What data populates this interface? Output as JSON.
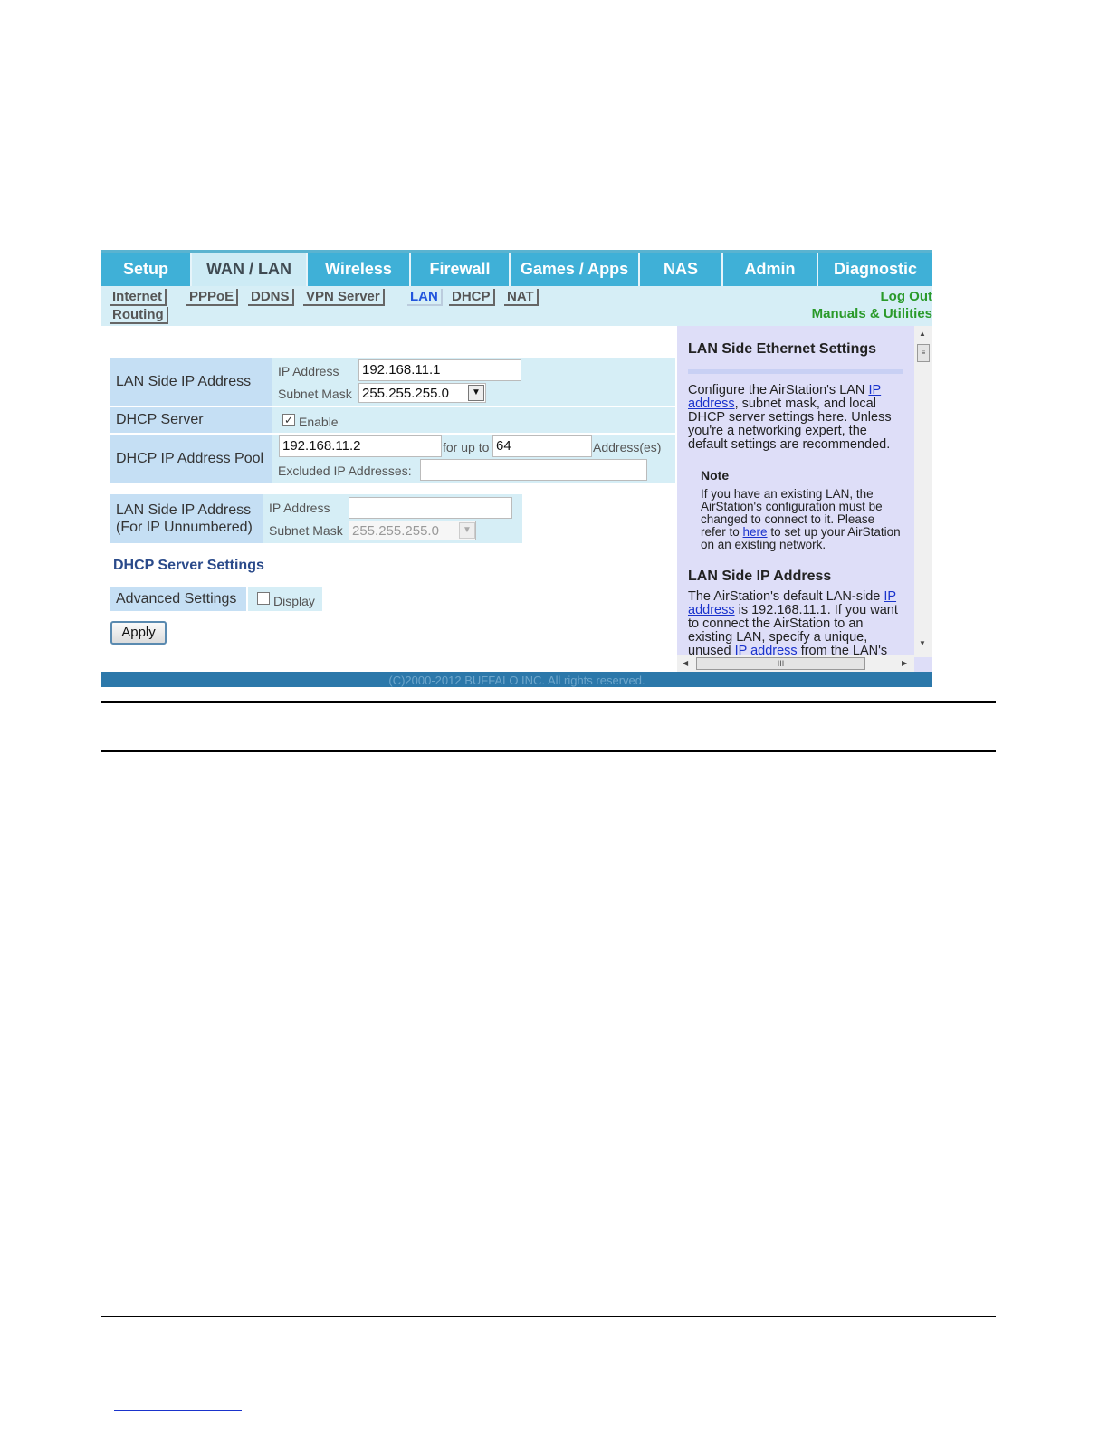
{
  "nav": {
    "tabs": [
      "Setup",
      "WAN / LAN",
      "Wireless",
      "Firewall",
      "Games / Apps",
      "NAS",
      "Admin",
      "Diagnostic"
    ],
    "active_tab": "WAN / LAN",
    "subtabs": [
      "Internet",
      "PPPoE",
      "DDNS",
      "VPN Server",
      "LAN",
      "DHCP",
      "NAT",
      "Routing"
    ],
    "active_subtab": "LAN",
    "logout": "Log Out",
    "manuals": "Manuals & Utilities"
  },
  "form": {
    "lan_ip_label": "LAN Side IP Address",
    "ip_address_label": "IP Address",
    "ip_address_value": "192.168.11.1",
    "subnet_mask_label": "Subnet Mask",
    "subnet_mask_value": "255.255.255.0",
    "dhcp_server_label": "DHCP Server",
    "dhcp_enable_label": "Enable",
    "pool_label": "DHCP IP Address Pool",
    "pool_start": "192.168.11.2",
    "for_up_to": "for up to",
    "pool_count": "64",
    "addresses_label": "Address(es)",
    "excluded_label": "Excluded IP Addresses:",
    "excluded_value": "",
    "unnumbered_label_1": "LAN Side IP Address",
    "unnumbered_label_2": "(For IP Unnumbered)",
    "unnumbered_ip_label": "IP Address",
    "unnumbered_ip_value": "",
    "unnumbered_mask_label": "Subnet Mask",
    "unnumbered_mask_value": "255.255.255.0",
    "dhcp_settings_heading": "DHCP Server Settings",
    "advanced_label": "Advanced Settings",
    "display_label": "Display",
    "apply_label": "Apply"
  },
  "help": {
    "title": "LAN Side Ethernet Settings",
    "intro_1": "Configure the AirStation's LAN ",
    "intro_link": "IP address",
    "intro_2": ", subnet mask, and local DHCP server settings here. Unless you're a networking expert, the default settings are recommended.",
    "note_title": "Note",
    "note_1": "If you have an existing LAN, the AirStation's configuration must be changed to connect to it. Please refer to ",
    "note_link": "here",
    "note_2": " to set up your AirStation on an existing network.",
    "section2_title": "LAN Side IP Address",
    "section2_1": "The AirStation's default LAN-side ",
    "section2_link": "IP address",
    "section2_2": " is 192.168.11.1. If you want to connect the AirStation to an existing LAN, specify a unique, unused ",
    "section2_link2": "IP address",
    "section2_3": " from the LAN's",
    "scroll_mark": "III"
  },
  "footer": {
    "copyright": "(C)2000-2012 BUFFALO INC. All rights reserved."
  }
}
